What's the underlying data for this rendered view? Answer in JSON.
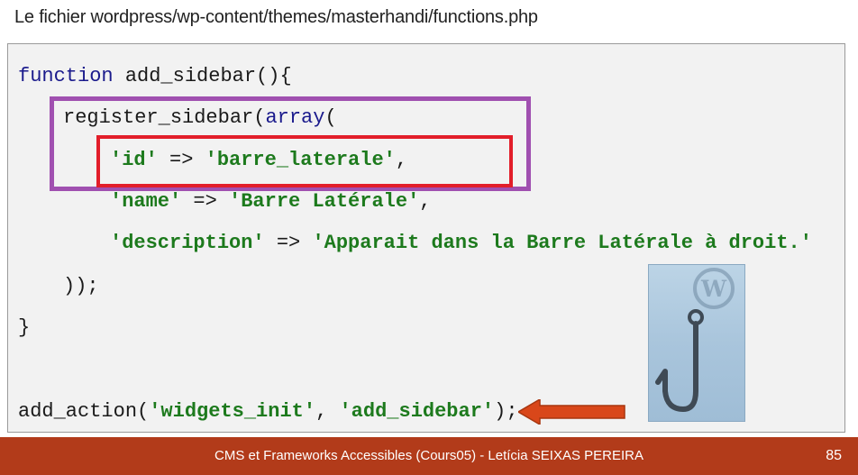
{
  "slide": {
    "title": "Le fichier wordpress/wp-content/themes/masterhandi/functions.php"
  },
  "code": {
    "l1_kw": "function",
    "l1_rest": " add_sidebar(){",
    "l2_pre": "register_sidebar(",
    "l2_kw": "array",
    "l2_post": "(",
    "l3_key": "'id'",
    "l3_op": " => ",
    "l3_val": "'barre_laterale'",
    "l3_end": ",",
    "l4_key": "'name'",
    "l4_op": " => ",
    "l4_val": "'Barre Latérale'",
    "l4_end": ",",
    "l5_key": "'description'",
    "l5_op": " => ",
    "l5_val": "'Apparait dans la Barre Latérale à droit.'",
    "l6": "));",
    "l7": "}",
    "l8_pre": "add_action(",
    "l8_arg1": "'widgets_init'",
    "l8_sep": ", ",
    "l8_arg2": "'add_sidebar'",
    "l8_end": ");"
  },
  "footer": {
    "text": "CMS et Frameworks Accessibles (Cours05) - Letícia SEIXAS PEREIRA",
    "page": "85"
  },
  "colors": {
    "footer_bg": "#b23b1a",
    "purple_box": "#a050b0",
    "red_box": "#e21e2a",
    "arrow": "#d9471a",
    "string": "#1d7a1d",
    "keyword": "#1a1a8c"
  },
  "icons": {
    "arrow": "left-arrow-icon",
    "hook": "wordpress-hook-icon"
  }
}
